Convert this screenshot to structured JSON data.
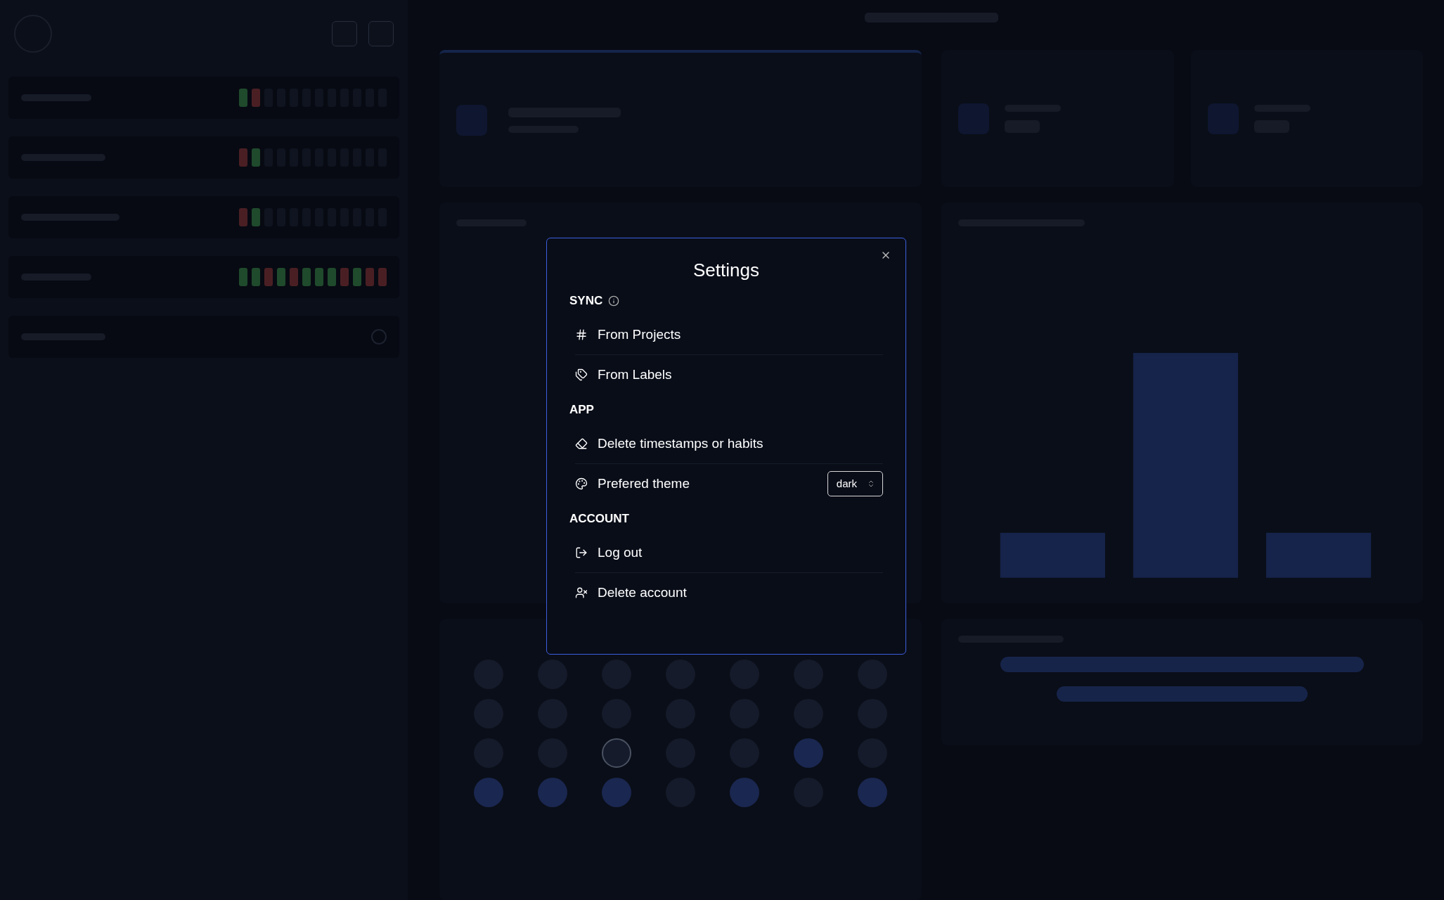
{
  "backdrop": {
    "habits": [
      {
        "kind": "cells",
        "cells": [
          {
            "color": "#1f4a2c"
          },
          {
            "color": "#4a1f24"
          },
          {
            "color": "#0f1420"
          },
          {
            "color": "#0f1420"
          },
          {
            "color": "#0f1420"
          },
          {
            "color": "#0f1420"
          },
          {
            "color": "#0f1420"
          },
          {
            "color": "#0f1420"
          },
          {
            "color": "#0f1420"
          },
          {
            "color": "#0f1420"
          },
          {
            "color": "#0f1420"
          },
          {
            "color": "#0f1420"
          }
        ]
      },
      {
        "kind": "cells",
        "cells": [
          {
            "color": "#4a1f24"
          },
          {
            "color": "#1f4a2c"
          },
          {
            "color": "#0f1420"
          },
          {
            "color": "#0f1420"
          },
          {
            "color": "#0f1420"
          },
          {
            "color": "#0f1420"
          },
          {
            "color": "#0f1420"
          },
          {
            "color": "#0f1420"
          },
          {
            "color": "#0f1420"
          },
          {
            "color": "#0f1420"
          },
          {
            "color": "#0f1420"
          },
          {
            "color": "#0f1420"
          }
        ]
      },
      {
        "kind": "cells",
        "cells": [
          {
            "color": "#4a1f24"
          },
          {
            "color": "#1f4a2c"
          },
          {
            "color": "#0f1420"
          },
          {
            "color": "#0f1420"
          },
          {
            "color": "#0f1420"
          },
          {
            "color": "#0f1420"
          },
          {
            "color": "#0f1420"
          },
          {
            "color": "#0f1420"
          },
          {
            "color": "#0f1420"
          },
          {
            "color": "#0f1420"
          },
          {
            "color": "#0f1420"
          },
          {
            "color": "#0f1420"
          }
        ]
      },
      {
        "kind": "cells",
        "cells": [
          {
            "color": "#1f4a2c"
          },
          {
            "color": "#1f4a2c"
          },
          {
            "color": "#4a1f24"
          },
          {
            "color": "#1f4a2c"
          },
          {
            "color": "#4a1f24"
          },
          {
            "color": "#1f4a2c"
          },
          {
            "color": "#1f4a2c"
          },
          {
            "color": "#1f4a2c"
          },
          {
            "color": "#4a1f24"
          },
          {
            "color": "#1f4a2c"
          },
          {
            "color": "#4a1f24"
          },
          {
            "color": "#4a1f24"
          }
        ]
      },
      {
        "kind": "icon"
      }
    ],
    "calendar_days": [
      {
        "marked": false,
        "today": false
      },
      {
        "marked": false,
        "today": false
      },
      {
        "marked": false,
        "today": false
      },
      {
        "marked": false,
        "today": false
      },
      {
        "marked": false,
        "today": false
      },
      {
        "marked": false,
        "today": false
      },
      {
        "marked": false,
        "today": false
      },
      {
        "marked": false,
        "today": false
      },
      {
        "marked": false,
        "today": false
      },
      {
        "marked": false,
        "today": false
      },
      {
        "marked": false,
        "today": false
      },
      {
        "marked": false,
        "today": false
      },
      {
        "marked": false,
        "today": false
      },
      {
        "marked": false,
        "today": false
      },
      {
        "marked": false,
        "today": false
      },
      {
        "marked": false,
        "today": false
      },
      {
        "marked": false,
        "today": true
      },
      {
        "marked": false,
        "today": false
      },
      {
        "marked": false,
        "today": false
      },
      {
        "marked": true,
        "today": false
      },
      {
        "marked": false,
        "today": false
      },
      {
        "marked": true,
        "today": false
      },
      {
        "marked": true,
        "today": false
      },
      {
        "marked": true,
        "today": false
      },
      {
        "marked": false,
        "today": false
      },
      {
        "marked": true,
        "today": false
      },
      {
        "marked": false,
        "today": false
      },
      {
        "marked": true,
        "today": false
      }
    ]
  },
  "settings": {
    "title": "Settings",
    "sections": [
      {
        "heading": "SYNC",
        "info": true,
        "items": [
          {
            "kind": "hash",
            "label": "From Projects"
          },
          {
            "kind": "tags",
            "label": "From Labels"
          }
        ]
      },
      {
        "heading": "APP",
        "info": false,
        "items": [
          {
            "kind": "eraser",
            "label": "Delete timestamps or habits"
          },
          {
            "kind": "palette",
            "label": "Prefered theme",
            "select": "dark"
          }
        ]
      },
      {
        "heading": "ACCOUNT",
        "info": false,
        "items": [
          {
            "kind": "logout",
            "label": "Log out"
          },
          {
            "kind": "userx",
            "label": "Delete account"
          }
        ]
      }
    ]
  }
}
